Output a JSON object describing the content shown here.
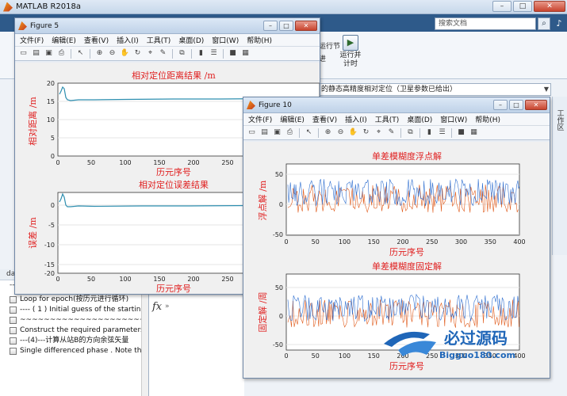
{
  "matlab": {
    "title": "MATLAB R2018a",
    "search_placeholder": "搜索文档",
    "ribbon": {
      "run_section": "运行节",
      "advance": "进",
      "run_time_line1": "运行并",
      "run_time_line2": "计时"
    },
    "path": "的静态高精度相对定位（卫星参数已给出）",
    "side_label": "工作区",
    "panel_header": "da",
    "panel_dashes": "----------",
    "panel_items": [
      "Loop for epoch(按历元进行循环)",
      "---- ( 1 ) Initial guess of the startin",
      "~~~~~~~~~~~~~~~~~~~~~~~~~~~~",
      "Construct the required parameters",
      "---(4)---计算从站B的方向余弦矢量",
      "Single differenced phase . Note th"
    ],
    "fx_symbol": "fx",
    "fx_prompt": "»"
  },
  "figure5": {
    "title": "Figure 5",
    "menu": [
      "文件(F)",
      "编辑(E)",
      "查看(V)",
      "插入(I)",
      "工具(T)",
      "桌面(D)",
      "窗口(W)",
      "帮助(H)"
    ],
    "plot1": {
      "title": "相对定位距离结果 /m",
      "ylabel": "相对距离 /m",
      "xlabel": "历元序号",
      "yticks": [
        "20",
        "15",
        "10",
        "5",
        "0"
      ],
      "xticks": [
        "0",
        "50",
        "100",
        "150",
        "200",
        "250",
        "300"
      ]
    },
    "plot2": {
      "title": "相对定位误差结果",
      "ylabel": "误差 /m",
      "xlabel": "历元序号",
      "yticks": [
        "0",
        "-5",
        "-10",
        "-15",
        "-20"
      ],
      "xticks": [
        "0",
        "50",
        "100",
        "150",
        "200",
        "250",
        "300"
      ]
    }
  },
  "figure10": {
    "title": "Figure 10",
    "menu": [
      "文件(F)",
      "编辑(E)",
      "查看(V)",
      "插入(I)",
      "工具(T)",
      "桌面(D)",
      "窗口(W)",
      "帮助(H)"
    ],
    "plot1": {
      "title": "单差模糊度浮点解",
      "ylabel": "浮点解 /m",
      "xlabel": "历元序号",
      "yticks": [
        "50",
        "0",
        "-50"
      ],
      "xticks": [
        "0",
        "50",
        "100",
        "150",
        "200",
        "250",
        "300",
        "350",
        "400"
      ]
    },
    "plot2": {
      "title": "单差模糊度固定解",
      "ylabel": "固定解 /周",
      "xlabel": "历元序号",
      "yticks": [
        "50",
        "0",
        "-50"
      ],
      "xticks": [
        "0",
        "50",
        "100",
        "150",
        "200",
        "250",
        "300",
        "350",
        "400"
      ]
    }
  },
  "watermark": {
    "brand": "必过源码",
    "url": "Bigguo180.com"
  },
  "colors": {
    "ribbon_blue": "#2e5a8a",
    "plot_title_red": "#e02020",
    "series_blue": "#2f6fd0",
    "series_orange": "#e05a1a",
    "series_teal": "#2e8fb0"
  }
}
